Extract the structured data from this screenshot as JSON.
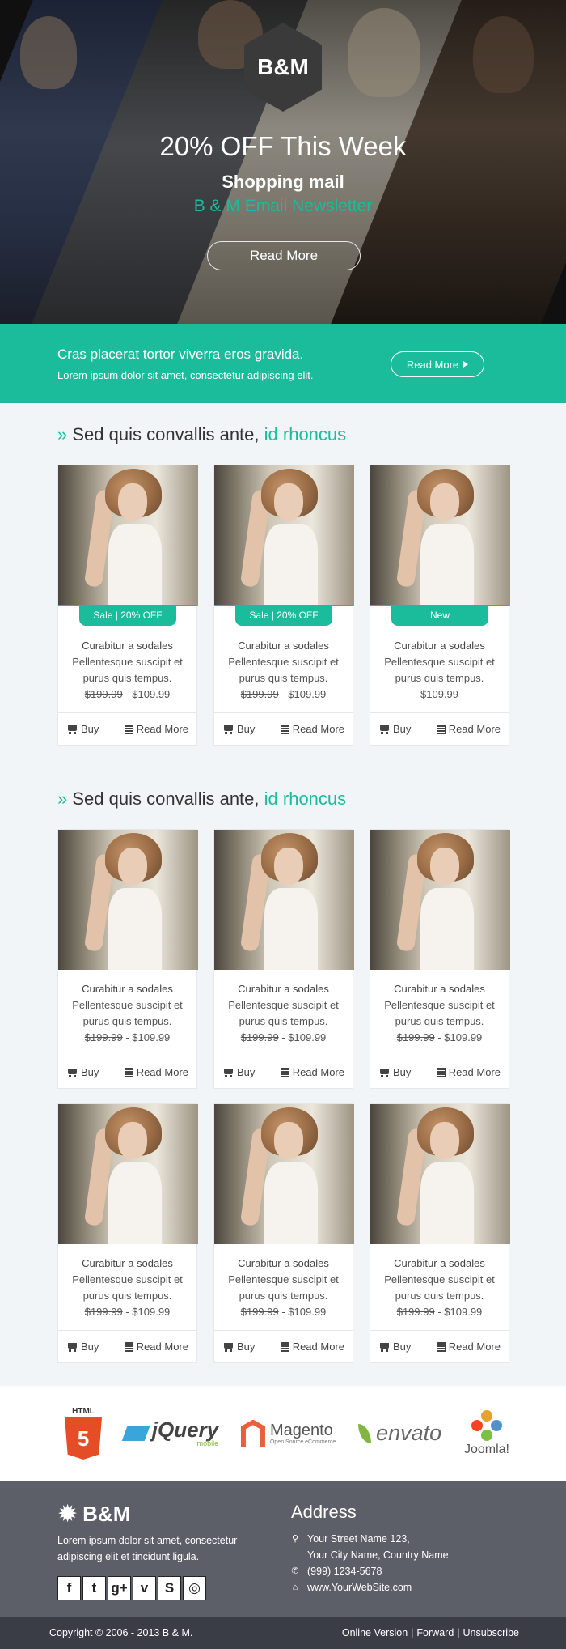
{
  "hero": {
    "logo": "B&M",
    "headline": "20% OFF This Week",
    "subtitle": "Shopping mail",
    "tagline": "B & M Email Newsletter",
    "button_label": "Read More"
  },
  "banner": {
    "title": "Cras placerat tortor viverra eros gravida.",
    "text": "Lorem ipsum dolor sit amet, consectetur adipiscing elit.",
    "button_label": "Read More"
  },
  "section1": {
    "raquo": "»",
    "title_plain": "Sed quis convallis ante,",
    "title_accent": "id rhoncus",
    "products": [
      {
        "badge": "Sale | 20% OFF",
        "name": "Curabitur a sodales",
        "desc1": "Pellentesque suscipit et",
        "desc2": "purus quis tempus.",
        "old_price": "$199.99",
        "sep": " - ",
        "price": "$109.99",
        "buy": "Buy",
        "read": "Read More"
      },
      {
        "badge": "Sale | 20% OFF",
        "name": "Curabitur a sodales",
        "desc1": "Pellentesque suscipit et",
        "desc2": "purus quis tempus.",
        "old_price": "$199.99",
        "sep": " - ",
        "price": "$109.99",
        "buy": "Buy",
        "read": "Read More"
      },
      {
        "badge": "New",
        "name": "Curabitur a sodales",
        "desc1": "Pellentesque suscipit et",
        "desc2": "purus quis tempus.",
        "old_price": "",
        "sep": "",
        "price": "$109.99",
        "buy": "Buy",
        "read": "Read More"
      }
    ]
  },
  "section2": {
    "raquo": "»",
    "title_plain": "Sed quis convallis ante,",
    "title_accent": "id rhoncus",
    "product": {
      "name": "Curabitur a sodales",
      "desc1": "Pellentesque suscipit et",
      "desc2": "purus quis tempus.",
      "old_price": "$199.99",
      "sep": " - ",
      "price": "$109.99",
      "buy": "Buy",
      "read": "Read More"
    }
  },
  "logos": {
    "html5_label": "HTML",
    "html5_mark": "5",
    "jquery": "jQuery",
    "jquery_sub": "mobile",
    "magento": "Magento",
    "magento_sub": "Open Source eCommerce",
    "envato": "envato",
    "joomla": "Joomla!"
  },
  "footer": {
    "brand": "B&M",
    "desc": "Lorem ipsum dolor sit amet, consectetur adipiscing elit et tincidunt ligula.",
    "social": [
      "f",
      "t",
      "g+",
      "v",
      "S",
      "◎"
    ],
    "address_title": "Address",
    "street": "Your Street Name 123,",
    "city": "Your City Name, Country Name",
    "phone": "(999) 1234-5678",
    "web": "www.YourWebSite.com",
    "copyright": "Copyright © 2006 - 2013 B & M.",
    "link_online": "Online Version",
    "link_forward": "Forward",
    "link_unsub": "Unsubscribe",
    "sep": "|"
  },
  "colors": {
    "accent": "#1abc9c",
    "footer_bg": "#5d5f68",
    "bottom_bg": "#3b3d46",
    "section_bg": "#f2f5f8"
  }
}
